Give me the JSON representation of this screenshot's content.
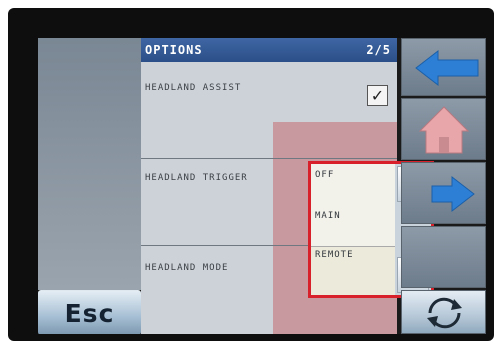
{
  "header": {
    "title": "OPTIONS",
    "page": "2/5"
  },
  "rows": [
    {
      "label": "HEADLAND ASSIST",
      "checked": true
    },
    {
      "label": "HEADLAND TRIGGER"
    },
    {
      "label": "HEADLAND MODE"
    }
  ],
  "checkbox_mark": "✓",
  "options": [
    "OFF",
    "MAIN",
    "REMOTE"
  ],
  "selected_option": "REMOTE",
  "buttons": {
    "esc": "Esc",
    "back_icon": "back-arrow-icon",
    "home_icon": "home-icon",
    "next_icon": "forward-arrow-icon",
    "scroll_up_icon": "triangle-up-icon",
    "scroll_down_icon": "triangle-down-icon",
    "refresh_icon": "refresh-icon"
  },
  "colors": {
    "header": "#2b4f88",
    "selection_border": "#d7202a",
    "arrow_blue": "#2d7fd6",
    "home_pink": "#e8a6ab"
  }
}
